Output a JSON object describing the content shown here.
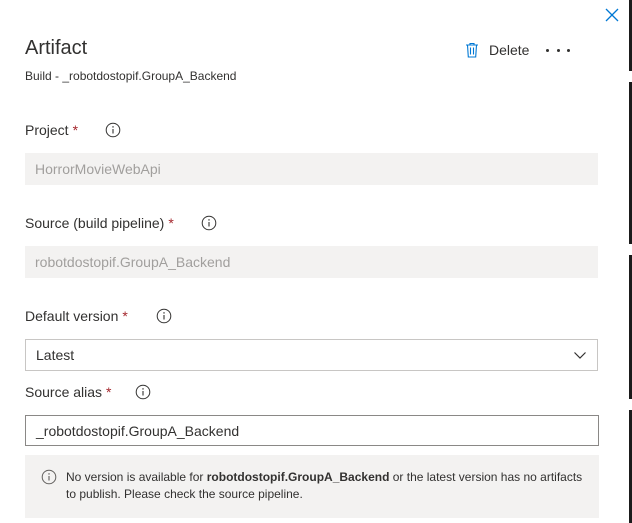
{
  "panel": {
    "title": "Artifact",
    "subtitle": "Build - _robotdostopif.GroupA_Backend",
    "delete_label": "Delete"
  },
  "fields": {
    "project": {
      "label": "Project",
      "required_mark": "*",
      "value": "HorrorMovieWebApi"
    },
    "source": {
      "label": "Source (build pipeline)",
      "required_mark": "*",
      "value": "robotdostopif.GroupA_Backend"
    },
    "default_version": {
      "label": "Default version",
      "required_mark": "*",
      "value": "Latest"
    },
    "source_alias": {
      "label": "Source alias",
      "required_mark": "*",
      "value": "_robotdostopif.GroupA_Backend"
    }
  },
  "notice": {
    "prefix": "No version is available for ",
    "pipeline": "robotdostopif.GroupA_Backend",
    "suffix": " or the latest version has no artifacts to publish. Please check the source pipeline."
  },
  "icons": [
    "close-icon",
    "trash-icon",
    "more-icon",
    "info-icon",
    "chevron-down-icon"
  ],
  "colors": {
    "required": "#a4262c",
    "disabled_bg": "#f3f2f1",
    "text": "#323130"
  }
}
